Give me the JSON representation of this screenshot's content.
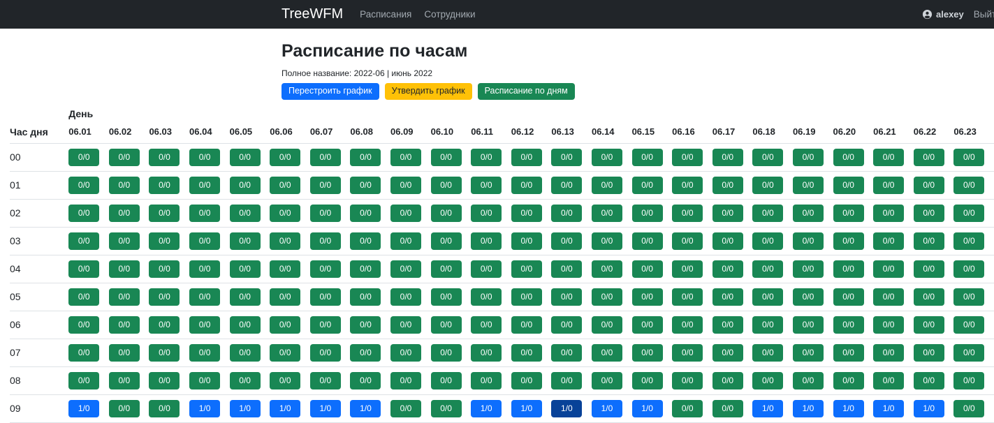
{
  "navbar": {
    "brand": "TreeWFM",
    "links": [
      {
        "label": "Расписания"
      },
      {
        "label": "Сотрудники"
      }
    ],
    "user": "alexey",
    "logout": "Выйти"
  },
  "page": {
    "title": "Расписание по часам",
    "subtitle": "Полное название: 2022-06 | июнь 2022",
    "buttons": [
      {
        "label": "Перестроить график",
        "style": "primary"
      },
      {
        "label": "Утвердить график",
        "style": "warning"
      },
      {
        "label": "Расписание по дням",
        "style": "success"
      }
    ]
  },
  "schedule": {
    "day_label": "День",
    "hour_label": "Час дня",
    "columns": [
      "06.01",
      "06.02",
      "06.03",
      "06.04",
      "06.05",
      "06.06",
      "06.07",
      "06.08",
      "06.09",
      "06.10",
      "06.11",
      "06.12",
      "06.13",
      "06.14",
      "06.15",
      "06.16",
      "06.17",
      "06.18",
      "06.19",
      "06.20",
      "06.21",
      "06.22",
      "06.23"
    ],
    "rows": [
      {
        "hour": "00",
        "cells": [
          "0/0|green",
          "0/0|green",
          "0/0|green",
          "0/0|green",
          "0/0|green",
          "0/0|green",
          "0/0|green",
          "0/0|green",
          "0/0|green",
          "0/0|green",
          "0/0|green",
          "0/0|green",
          "0/0|green",
          "0/0|green",
          "0/0|green",
          "0/0|green",
          "0/0|green",
          "0/0|green",
          "0/0|green",
          "0/0|green",
          "0/0|green",
          "0/0|green",
          "0/0|green"
        ]
      },
      {
        "hour": "01",
        "cells": [
          "0/0|green",
          "0/0|green",
          "0/0|green",
          "0/0|green",
          "0/0|green",
          "0/0|green",
          "0/0|green",
          "0/0|green",
          "0/0|green",
          "0/0|green",
          "0/0|green",
          "0/0|green",
          "0/0|green",
          "0/0|green",
          "0/0|green",
          "0/0|green",
          "0/0|green",
          "0/0|green",
          "0/0|green",
          "0/0|green",
          "0/0|green",
          "0/0|green",
          "0/0|green"
        ]
      },
      {
        "hour": "02",
        "cells": [
          "0/0|green",
          "0/0|green",
          "0/0|green",
          "0/0|green",
          "0/0|green",
          "0/0|green",
          "0/0|green",
          "0/0|green",
          "0/0|green",
          "0/0|green",
          "0/0|green",
          "0/0|green",
          "0/0|green",
          "0/0|green",
          "0/0|green",
          "0/0|green",
          "0/0|green",
          "0/0|green",
          "0/0|green",
          "0/0|green",
          "0/0|green",
          "0/0|green",
          "0/0|green"
        ]
      },
      {
        "hour": "03",
        "cells": [
          "0/0|green",
          "0/0|green",
          "0/0|green",
          "0/0|green",
          "0/0|green",
          "0/0|green",
          "0/0|green",
          "0/0|green",
          "0/0|green",
          "0/0|green",
          "0/0|green",
          "0/0|green",
          "0/0|green",
          "0/0|green",
          "0/0|green",
          "0/0|green",
          "0/0|green",
          "0/0|green",
          "0/0|green",
          "0/0|green",
          "0/0|green",
          "0/0|green",
          "0/0|green"
        ]
      },
      {
        "hour": "04",
        "cells": [
          "0/0|green",
          "0/0|green",
          "0/0|green",
          "0/0|green",
          "0/0|green",
          "0/0|green",
          "0/0|green",
          "0/0|green",
          "0/0|green",
          "0/0|green",
          "0/0|green",
          "0/0|green",
          "0/0|green",
          "0/0|green",
          "0/0|green",
          "0/0|green",
          "0/0|green",
          "0/0|green",
          "0/0|green",
          "0/0|green",
          "0/0|green",
          "0/0|green",
          "0/0|green"
        ]
      },
      {
        "hour": "05",
        "cells": [
          "0/0|green",
          "0/0|green",
          "0/0|green",
          "0/0|green",
          "0/0|green",
          "0/0|green",
          "0/0|green",
          "0/0|green",
          "0/0|green",
          "0/0|green",
          "0/0|green",
          "0/0|green",
          "0/0|green",
          "0/0|green",
          "0/0|green",
          "0/0|green",
          "0/0|green",
          "0/0|green",
          "0/0|green",
          "0/0|green",
          "0/0|green",
          "0/0|green",
          "0/0|green"
        ]
      },
      {
        "hour": "06",
        "cells": [
          "0/0|green",
          "0/0|green",
          "0/0|green",
          "0/0|green",
          "0/0|green",
          "0/0|green",
          "0/0|green",
          "0/0|green",
          "0/0|green",
          "0/0|green",
          "0/0|green",
          "0/0|green",
          "0/0|green",
          "0/0|green",
          "0/0|green",
          "0/0|green",
          "0/0|green",
          "0/0|green",
          "0/0|green",
          "0/0|green",
          "0/0|green",
          "0/0|green",
          "0/0|green"
        ]
      },
      {
        "hour": "07",
        "cells": [
          "0/0|green",
          "0/0|green",
          "0/0|green",
          "0/0|green",
          "0/0|green",
          "0/0|green",
          "0/0|green",
          "0/0|green",
          "0/0|green",
          "0/0|green",
          "0/0|green",
          "0/0|green",
          "0/0|green",
          "0/0|green",
          "0/0|green",
          "0/0|green",
          "0/0|green",
          "0/0|green",
          "0/0|green",
          "0/0|green",
          "0/0|green",
          "0/0|green",
          "0/0|green"
        ]
      },
      {
        "hour": "08",
        "cells": [
          "0/0|green",
          "0/0|green",
          "0/0|green",
          "0/0|green",
          "0/0|green",
          "0/0|green",
          "0/0|green",
          "0/0|green",
          "0/0|green",
          "0/0|green",
          "0/0|green",
          "0/0|green",
          "0/0|green",
          "0/0|green",
          "0/0|green",
          "0/0|green",
          "0/0|green",
          "0/0|green",
          "0/0|green",
          "0/0|green",
          "0/0|green",
          "0/0|green",
          "0/0|green"
        ]
      },
      {
        "hour": "09",
        "cells": [
          "1/0|blue",
          "0/0|green",
          "0/0|green",
          "1/0|blue",
          "1/0|blue",
          "1/0|blue",
          "1/0|blue",
          "1/0|blue",
          "0/0|green",
          "0/0|green",
          "1/0|blue",
          "1/0|blue",
          "1/0|blue-dark",
          "1/0|blue",
          "1/0|blue",
          "0/0|green",
          "0/0|green",
          "1/0|blue",
          "1/0|blue",
          "1/0|blue",
          "1/0|blue",
          "1/0|blue",
          "0/0|green"
        ]
      }
    ]
  },
  "colors": {
    "navbar-bg": "#212529",
    "nav-link": "#a2a9b0",
    "primary": "#0d6efd",
    "primary-dark": "#084298",
    "success": "#198754",
    "warning": "#ffc107",
    "warning-text": "#212529",
    "border": "#dee2e6",
    "text": "#212529"
  }
}
